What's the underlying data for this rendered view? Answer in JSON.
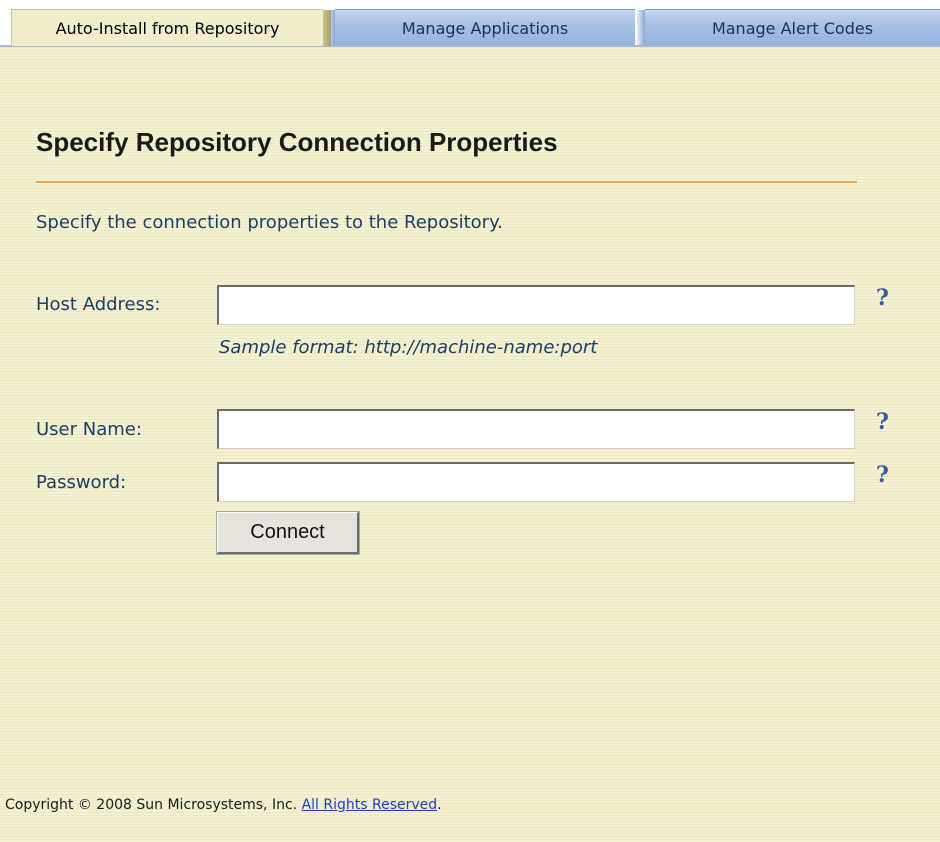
{
  "tabs": [
    {
      "label": "Auto-Install from Repository",
      "active": true
    },
    {
      "label": "Manage Applications",
      "active": false
    },
    {
      "label": "Manage Alert Codes",
      "active": false
    }
  ],
  "main": {
    "title": "Specify Repository Connection Properties",
    "instruction": "Specify the connection properties to the Repository.",
    "host": {
      "label": "Host Address:",
      "value": "",
      "hint": "Sample format: http://machine-name:port"
    },
    "user": {
      "label": "User Name:",
      "value": ""
    },
    "password": {
      "label": "Password:",
      "value": ""
    },
    "help_glyph": "?",
    "connect_label": "Connect"
  },
  "footer": {
    "copyright": "Copyright © 2008 Sun Microsystems, Inc.",
    "rights_link": "All Rights Reserved",
    "period": "."
  },
  "colors": {
    "background": "#f2f0cd",
    "accent_rule": "#e5a84e",
    "active_tab": "#f0eecb",
    "inactive_tab": "#a7c0e3",
    "label_text": "#1d3e63",
    "help_icon": "#3a55a4"
  }
}
